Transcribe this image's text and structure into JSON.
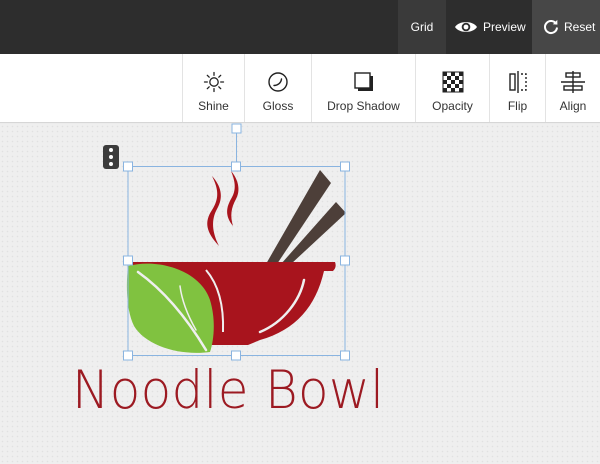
{
  "topbar": {
    "grid_label": "Grid",
    "preview_label": "Preview",
    "reset_label": "Reset",
    "icons": {
      "preview": "eye-icon",
      "reset": "refresh-icon"
    }
  },
  "toolbar": {
    "tools": [
      {
        "label": "Shine",
        "icon": "sun-icon"
      },
      {
        "label": "Gloss",
        "icon": "gloss-icon"
      },
      {
        "label": "Drop Shadow",
        "icon": "drop-shadow-icon"
      },
      {
        "label": "Opacity",
        "icon": "checkerboard-icon"
      },
      {
        "label": "Flip",
        "icon": "flip-icon"
      },
      {
        "label": "Align",
        "icon": "align-icon"
      }
    ]
  },
  "canvas": {
    "brand_name": "Noodle Bowl",
    "colors": {
      "bowl": "#a8141d",
      "text": "#9c1a22",
      "leaf": "#80c240",
      "chopsticks": "#4d3f39",
      "selection": "#8ab4e0"
    }
  }
}
